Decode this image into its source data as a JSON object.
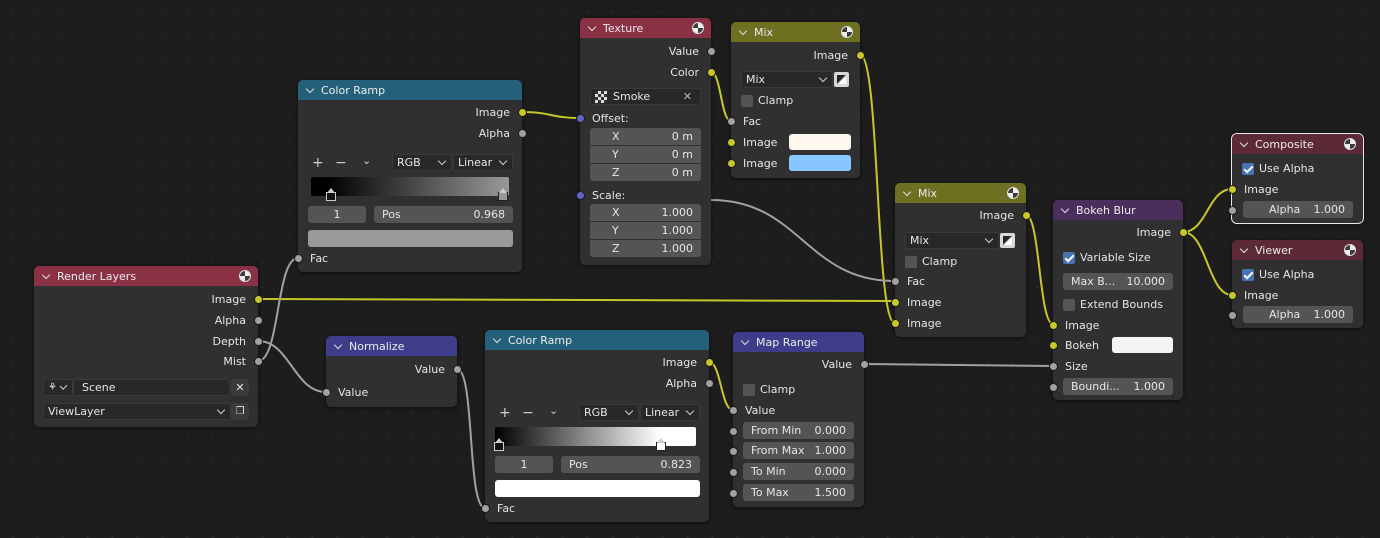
{
  "nodes": {
    "render_layers": {
      "title": "Render Layers",
      "outputs": [
        "Image",
        "Alpha",
        "Depth",
        "Mist"
      ],
      "scene": "Scene",
      "view_layer": "ViewLayer",
      "color": "#8b3145"
    },
    "color_ramp_1": {
      "title": "Color Ramp",
      "outputs": [
        "Image",
        "Alpha"
      ],
      "color_mode": "RGB",
      "interpolation": "Linear",
      "stop_index": "1",
      "pos_label": "Pos",
      "pos_value": "0.968",
      "input": "Fac",
      "color": "#24607a"
    },
    "texture": {
      "title": "Texture",
      "outputs": [
        "Value",
        "Color"
      ],
      "texture_name": "Smoke",
      "offset_label": "Offset:",
      "offset": [
        {
          "axis": "X",
          "value": "0 m"
        },
        {
          "axis": "Y",
          "value": "0 m"
        },
        {
          "axis": "Z",
          "value": "0 m"
        }
      ],
      "scale_label": "Scale:",
      "scale": [
        {
          "axis": "X",
          "value": "1.000"
        },
        {
          "axis": "Y",
          "value": "1.000"
        },
        {
          "axis": "Z",
          "value": "1.000"
        }
      ],
      "color": "#8b3145"
    },
    "mix_1": {
      "title": "Mix",
      "output": "Image",
      "blend": "Mix",
      "clamp": "Clamp",
      "fac": "Fac",
      "image1": "Image",
      "image2": "Image",
      "image1_color": "#fdf7ee",
      "image2_color": "#88c6ff",
      "color": "#6f6f21"
    },
    "mix_2": {
      "title": "Mix",
      "output": "Image",
      "blend": "Mix",
      "clamp": "Clamp",
      "fac": "Fac",
      "image1": "Image",
      "image2": "Image",
      "color": "#6f6f21"
    },
    "normalize": {
      "title": "Normalize",
      "output": "Value",
      "input": "Value",
      "color": "#3d3d8a"
    },
    "color_ramp_2": {
      "title": "Color Ramp",
      "outputs": [
        "Image",
        "Alpha"
      ],
      "color_mode": "RGB",
      "interpolation": "Linear",
      "stop_index": "1",
      "pos_label": "Pos",
      "pos_value": "0.823",
      "input": "Fac",
      "color": "#24607a"
    },
    "map_range": {
      "title": "Map Range",
      "output": "Value",
      "clamp": "Clamp",
      "input": "Value",
      "fields": [
        {
          "label": "From Min",
          "value": "0.000"
        },
        {
          "label": "From Max",
          "value": "1.000"
        },
        {
          "label": "To Min",
          "value": "0.000"
        },
        {
          "label": "To Max",
          "value": "1.500"
        }
      ],
      "color": "#3d3d8a"
    },
    "bokeh_blur": {
      "title": "Bokeh Blur",
      "output": "Image",
      "variable_size": "Variable Size",
      "max_blur_label": "Max B...",
      "max_blur_value": "10.000",
      "extend_bounds": "Extend Bounds",
      "image": "Image",
      "bokeh": "Bokeh",
      "size": "Size",
      "bounding_label": "Boundi...",
      "bounding_value": "1.000",
      "color": "#4a2e5c"
    },
    "composite": {
      "title": "Composite",
      "use_alpha": "Use Alpha",
      "image": "Image",
      "alpha_label": "Alpha",
      "alpha_value": "1.000",
      "color": "#5c2a36"
    },
    "viewer": {
      "title": "Viewer",
      "use_alpha": "Use Alpha",
      "image": "Image",
      "alpha_label": "Alpha",
      "alpha_value": "1.000",
      "color": "#5c2a36"
    }
  }
}
